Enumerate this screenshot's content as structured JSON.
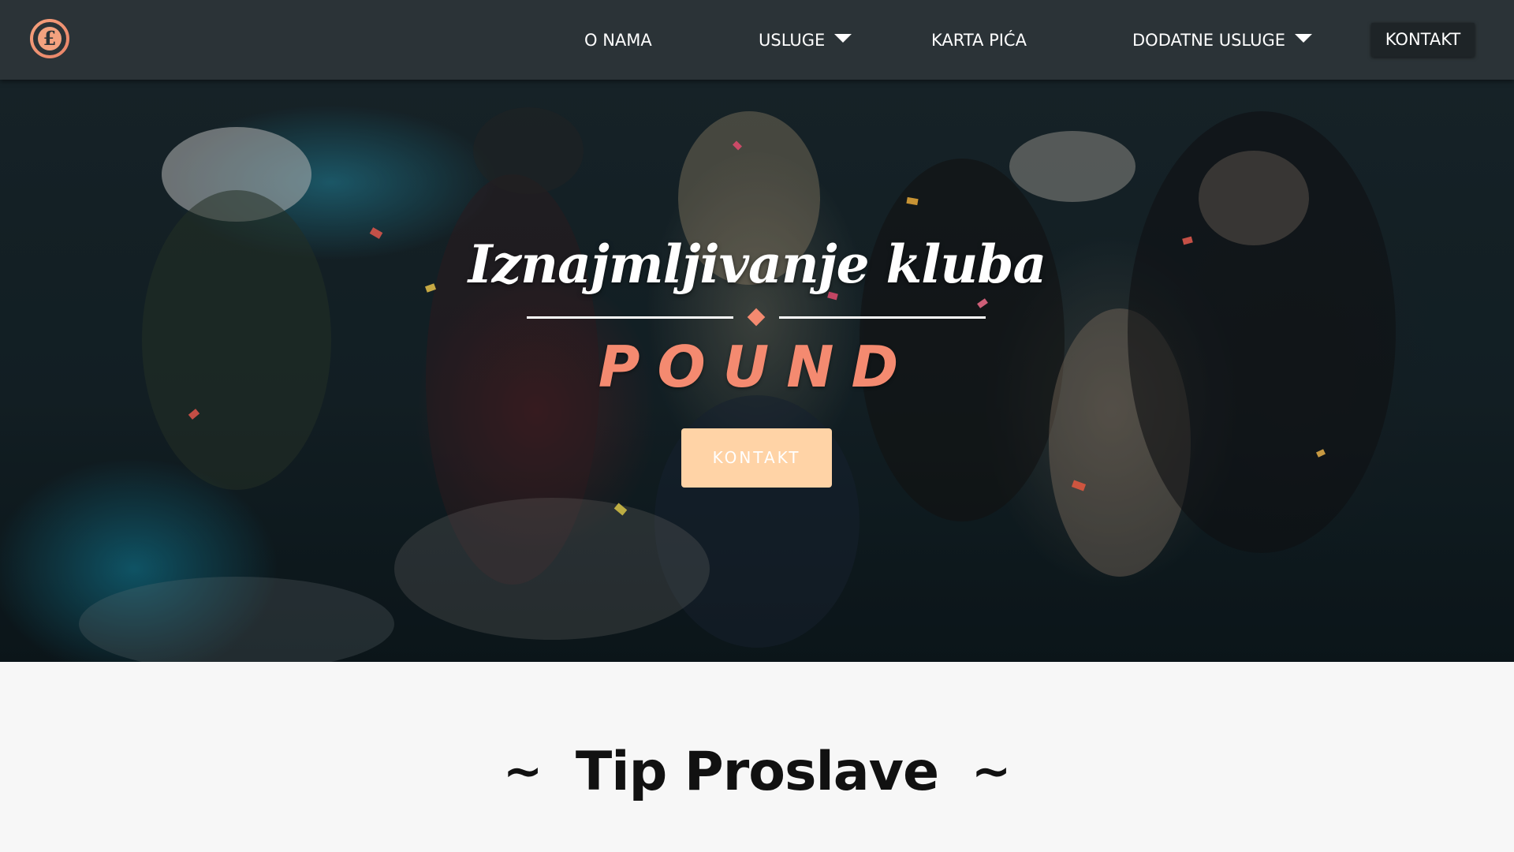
{
  "colors": {
    "navbar_bg": "#2b3337",
    "accent": "#f48a70",
    "cta_bg": "#ffd3a6",
    "section_bg": "#f7f7f7",
    "text_dark": "#111111"
  },
  "navbar": {
    "logo_icon": "pound-sign-icon",
    "logo_glyph": "£",
    "items": [
      {
        "label": "O NAMA"
      },
      {
        "label": "USLUGE",
        "dropdown_icon": "caret-down-icon"
      },
      {
        "label": "KARTA PIĆA"
      },
      {
        "label": "DODATNE USLUGE",
        "dropdown_icon": "caret-down-icon"
      }
    ],
    "contact_label": "KONTAKT"
  },
  "hero": {
    "title": "Iznajmljivanje kluba",
    "brand": "POUND",
    "cta_label": "KONTAKT"
  },
  "section": {
    "title": "Tip Proslave",
    "left_ornament": "~",
    "right_ornament": "~"
  }
}
